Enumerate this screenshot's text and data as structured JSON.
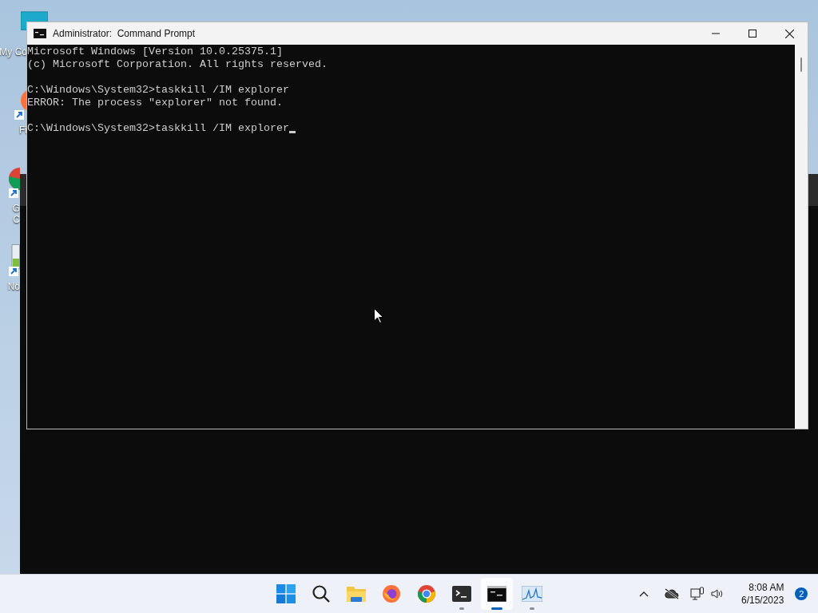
{
  "desktop_icons": [
    {
      "kind": "computer",
      "lines": [
        "My Co"
      ]
    },
    {
      "kind": "firefox",
      "lines": [
        "Fi"
      ]
    },
    {
      "kind": "chrome",
      "lines": [
        "G",
        "C"
      ]
    },
    {
      "kind": "notepad",
      "lines": [
        "No"
      ]
    }
  ],
  "window": {
    "title": "Administrator:  Command Prompt"
  },
  "console": {
    "blocks": [
      {
        "lines": [
          "Microsoft Windows [Version 10.0.25375.1]",
          "(c) Microsoft Corporation. All rights reserved."
        ]
      },
      {
        "lines": [
          "C:\\Windows\\System32>taskkill /IM explorer",
          "ERROR: The process \"explorer\" not found."
        ]
      },
      {
        "lines": [
          "C:\\Windows\\System32>taskkill /IM explorer"
        ]
      }
    ],
    "cursor": true
  },
  "taskbar": {
    "apps": [
      {
        "kind": "start",
        "running": false,
        "selected": false
      },
      {
        "kind": "search",
        "running": false,
        "selected": false
      },
      {
        "kind": "files",
        "running": false,
        "selected": false
      },
      {
        "kind": "firefox",
        "running": false,
        "selected": false
      },
      {
        "kind": "chrome",
        "running": false,
        "selected": false
      },
      {
        "kind": "terminal",
        "running": true,
        "selected": false
      },
      {
        "kind": "cmd",
        "running": true,
        "selected": true
      },
      {
        "kind": "monitor",
        "running": true,
        "selected": false
      }
    ],
    "time": "8:08 AM",
    "date": "6/15/2023",
    "notifications": "2"
  }
}
